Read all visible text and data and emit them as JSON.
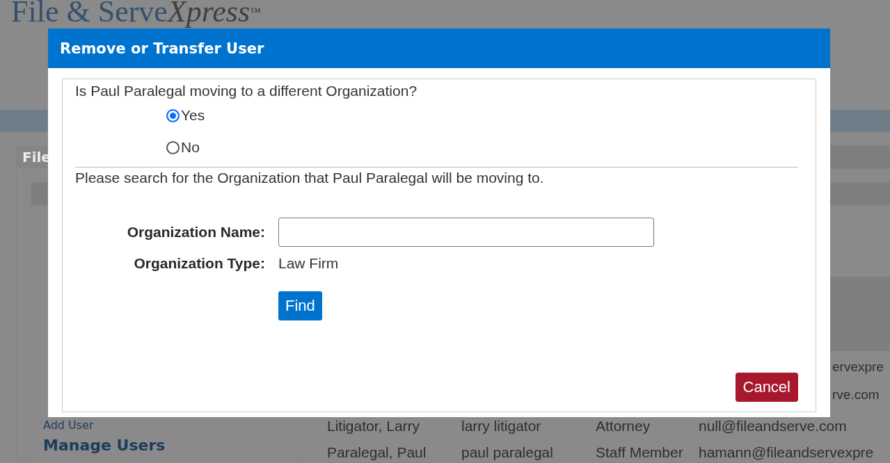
{
  "background": {
    "logo": {
      "main": "File & Serve",
      "accent": "Xpress",
      "mark": "™"
    },
    "panel_title": "File",
    "sidebar": {
      "link": "Add User",
      "heading": "Manage Users"
    },
    "rows": [
      [
        "Litigator, Larry",
        "larry litigator",
        "Attorney",
        "null@fileandserve.com"
      ],
      [
        "Paralegal, Paul",
        "paul paralegal",
        "Staff Member",
        "hamann@fileandservexpre"
      ]
    ],
    "edge_texts": [
      "ervexpre",
      "rve.com"
    ]
  },
  "dialog": {
    "title": "Remove or Transfer User",
    "question": "Is Paul Paralegal moving to a different Organization?",
    "options": [
      {
        "label": "Yes",
        "selected": true
      },
      {
        "label": "No",
        "selected": false
      }
    ],
    "instruction": "Please search for the Organization that Paul Paralegal will be moving to.",
    "fields": [
      {
        "kind": "input",
        "label": "Organization Name:"
      },
      {
        "kind": "text",
        "label": "Organization Type:",
        "value": "Law Firm"
      }
    ],
    "find_button": "Find",
    "cancel_button": "Cancel"
  }
}
